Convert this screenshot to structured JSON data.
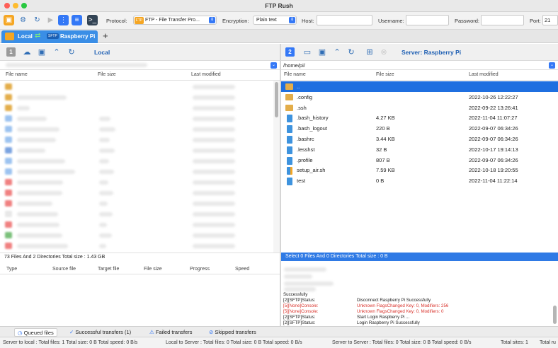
{
  "window": {
    "title": "FTP Rush"
  },
  "toolbar": {
    "protocol_label": "Protocol:",
    "protocol_value": "FTP - File Transfer Pro...",
    "encryption_label": "Encryption:",
    "encryption_value": "Plain text",
    "host_label": "Host:",
    "username_label": "Username:",
    "password_label": "Password:",
    "port_label": "Port:",
    "port_value": "21"
  },
  "tab": {
    "local_label": "Local",
    "remote_label": "Raspberry Pi",
    "sftp_badge": "SFTP",
    "add_label": "+"
  },
  "left_pane": {
    "number": "1",
    "title": "Local",
    "columns": [
      "File name",
      "File size",
      "Last modified"
    ],
    "status": "73 Files And 2 Directories Total size : 1.43 GB"
  },
  "right_pane": {
    "number": "2",
    "title": "Server:  Raspberry Pi",
    "path": "/home/pi/",
    "columns": [
      "File name",
      "File size",
      "Last modified"
    ],
    "rows": [
      {
        "name": "..",
        "size": "",
        "modified": "",
        "type": "folder",
        "selected": true
      },
      {
        "name": ".config",
        "size": "",
        "modified": "2022-10-26 12:22:27",
        "type": "folder"
      },
      {
        "name": ".ssh",
        "size": "",
        "modified": "2022-09-22 13:26:41",
        "type": "folder"
      },
      {
        "name": ".bash_history",
        "size": "4.27 KB",
        "modified": "2022-11-04 11:07:27",
        "type": "file"
      },
      {
        "name": ".bash_logout",
        "size": "220 B",
        "modified": "2022-09-07 06:34:26",
        "type": "file"
      },
      {
        "name": ".bashrc",
        "size": "3.44 KB",
        "modified": "2022-09-07 06:34:26",
        "type": "file"
      },
      {
        "name": ".lesshst",
        "size": "32 B",
        "modified": "2022-10-17 19:14:13",
        "type": "file"
      },
      {
        "name": ".profile",
        "size": "807 B",
        "modified": "2022-09-07 06:34:26",
        "type": "file"
      },
      {
        "name": "setup_air.sh",
        "size": "7.59 KB",
        "modified": "2022-10-18 19:20:55",
        "type": "script"
      },
      {
        "name": "test",
        "size": "0 B",
        "modified": "2022-11-04 11:22:14",
        "type": "file"
      }
    ],
    "status": "Select 0 Files And 0 Directories Total size : 0 B"
  },
  "queue": {
    "columns": [
      "Type",
      "Source file",
      "Target file",
      "File size",
      "Progress",
      "Speed"
    ]
  },
  "log": [
    {
      "left": "Successfully",
      "right": "",
      "color": "#222"
    },
    {
      "left": "[2][SFTP]Status:",
      "right": "Disconnect Raspberry Pi Successfully",
      "color": "#222"
    },
    {
      "left": "[5][None]Console:",
      "right": "Unknown FlagsChanged Key: 0, Modifiers: 256",
      "color": "#d9322b"
    },
    {
      "left": "[5][None]Console:",
      "right": "Unknown FlagsChanged Key: 0, Modifiers: 0",
      "color": "#d9322b"
    },
    {
      "left": "[2][SFTP]Status:",
      "right": "Start Login Raspberry Pi ...",
      "color": "#222"
    },
    {
      "left": "[2][SFTP]Status:",
      "right": "Login Raspberry Pi Successfully",
      "color": "#222"
    }
  ],
  "bottom_tabs": [
    "Queued files",
    "Successful transfers (1)",
    "Failed transfers",
    "Skipped transfers"
  ],
  "footer": {
    "s2l": "Server to local : Total files: 1  Total size: 0 B  Total speed: 0 B/s",
    "l2s": "Local to Server : Total files: 0  Total size: 0 B  Total speed: 0 B/s",
    "s2s": "Server to Server : Total files: 0  Total size: 0 B  Total speed: 0 B/s",
    "sites": "Total sites: 1",
    "tail": "Total ru"
  },
  "colors": {
    "accent": "#3478f6",
    "selection": "#1f6fe0",
    "folder": "#e3ad4a",
    "file": "#3e93de"
  }
}
